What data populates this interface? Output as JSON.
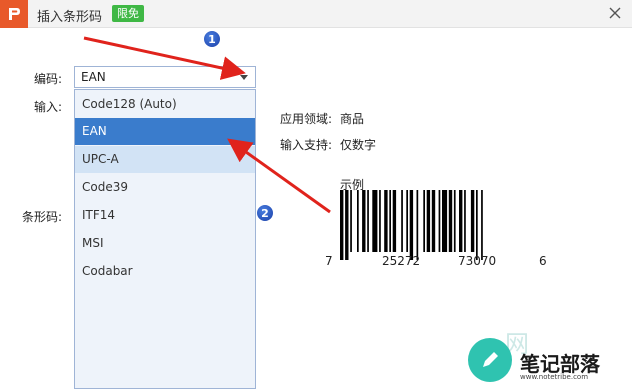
{
  "titlebar": {
    "title": "插入条形码",
    "badge": "限免"
  },
  "form": {
    "encoding_label": "编码:",
    "input_label": "输入:",
    "barcode_label": "条形码:",
    "selected_value": "EAN"
  },
  "dropdown": {
    "options": [
      "Code128 (Auto)",
      "EAN",
      "UPC-A",
      "Code39",
      "ITF14",
      "MSI",
      "Codabar"
    ],
    "selected": "EAN",
    "hovered": "UPC-A"
  },
  "info": {
    "domain_label": "应用领域:",
    "domain_value": "商品",
    "support_label": "输入支持:",
    "support_value": "仅数字"
  },
  "preview": {
    "caption": "示例",
    "digits": [
      "7",
      "25272",
      "73070",
      "6"
    ]
  },
  "annotations": {
    "marker1": "1",
    "marker2": "2"
  },
  "watermark": {
    "text": "笔记部落",
    "url": "www.notetribe.com",
    "bg_text": "网"
  },
  "colors": {
    "logo": "#e8592a",
    "badge": "#3fb845",
    "selected": "#3a7ccc",
    "arrow": "#e0231c",
    "marker": "#1a3fa8",
    "watermark": "#2fc3b0"
  }
}
